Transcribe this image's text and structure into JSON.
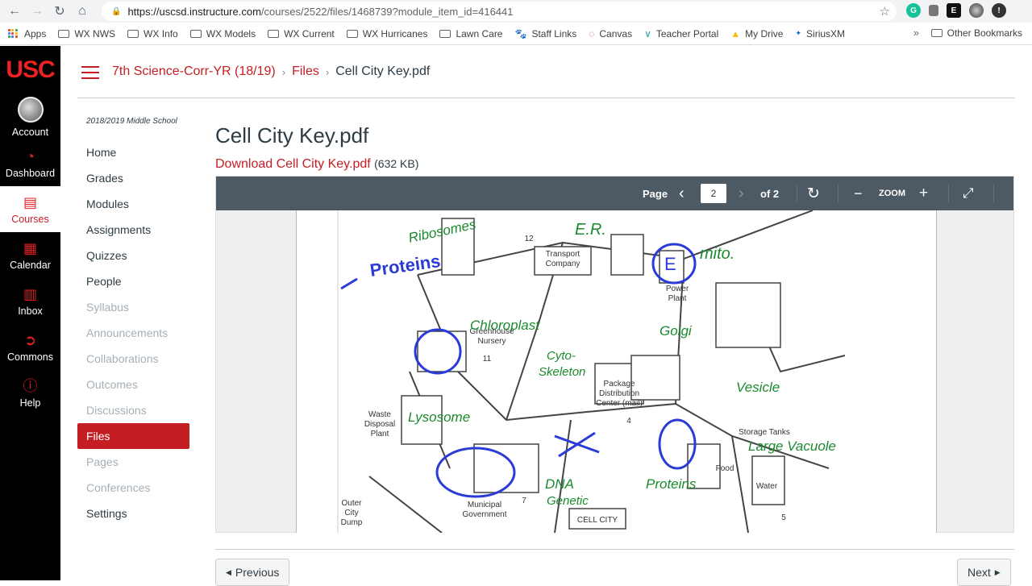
{
  "browser": {
    "url_host": "https://uscsd.instructure.com",
    "url_path": "/courses/2522/files/1468739?module_item_id=416441",
    "bookmarks": [
      "Apps",
      "WX NWS",
      "WX Info",
      "WX Models",
      "WX Current",
      "WX Hurricanes",
      "Lawn Care",
      "Staff Links",
      "Canvas",
      "Teacher Portal",
      "My Drive",
      "SiriusXM"
    ],
    "other_bookmarks": "Other Bookmarks"
  },
  "global_nav": {
    "logo": "USC",
    "items": [
      "Account",
      "Dashboard",
      "Courses",
      "Calendar",
      "Inbox",
      "Commons",
      "Help"
    ]
  },
  "breadcrumb": {
    "course": "7th Science-Corr-YR (18/19)",
    "section": "Files",
    "current": "Cell City Key.pdf"
  },
  "course_nav": {
    "term": "2018/2019 Middle School",
    "items": [
      "Home",
      "Grades",
      "Modules",
      "Assignments",
      "Quizzes",
      "People",
      "Syllabus",
      "Announcements",
      "Collaborations",
      "Outcomes",
      "Discussions",
      "Files",
      "Pages",
      "Conferences",
      "Settings"
    ]
  },
  "content": {
    "title": "Cell City Key.pdf",
    "download_label": "Download Cell City Key.pdf",
    "size": "(632 KB)"
  },
  "viewer": {
    "page_label": "Page",
    "page_value": "2",
    "of_label": "of 2",
    "zoom_label": "ZOOM"
  },
  "pdf_labels": {
    "ribosomes": "Ribosomes",
    "proteins": "Proteins",
    "er": "E.R.",
    "transport": "Transport",
    "company": "Company",
    "mito": "mito.",
    "power": "Power",
    "plant": "Plant",
    "chloroplast": "Chloroplast",
    "greenhouse": "Greenhouse",
    "nursery": "Nursery",
    "golgi": "Golgi",
    "cyto": "Cyto-",
    "skeleton": "Skeleton",
    "package": "Package",
    "distribution": "Distribution",
    "center": "Center (mail)",
    "vesicle": "Vesicle",
    "waste": "Waste",
    "disposal": "Disposal",
    "plant2": "Plant",
    "lysosome": "Lysosome",
    "storage": "Storage Tanks",
    "vacuole": "Large Vacuole",
    "food": "Food",
    "water": "Water",
    "proteins2": "Proteins",
    "dna": "DNA",
    "genetic": "Genetic",
    "municipal": "Municipal",
    "government": "Government",
    "outer": "Outer",
    "city": "City",
    "dump": "Dump",
    "cellcity": "CELL CITY",
    "n12": "12",
    "n11": "11",
    "n4": "4",
    "n7": "7",
    "n5": "5",
    "e_mark": "E"
  },
  "pager": {
    "prev": "Previous",
    "next": "Next"
  }
}
